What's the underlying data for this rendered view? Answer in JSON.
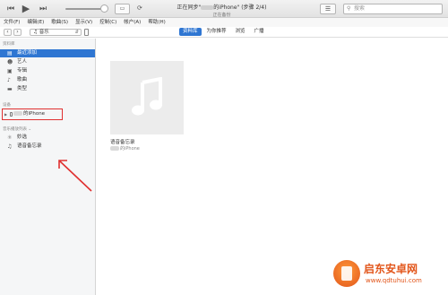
{
  "player": {
    "prev_icon": "previous-icon",
    "play_icon": "play-icon",
    "next_icon": "next-icon",
    "airplay_icon": "airplay-icon",
    "sync_icon": "sync-icon",
    "status_line1_prefix": "正在同步\"",
    "status_line1_suffix": "的iPhone\" (步骤 2/4)",
    "status_line2": "正在备份",
    "list_icon": "list-icon",
    "search_placeholder": "搜索"
  },
  "menu": [
    "文件(F)",
    "编辑(E)",
    "歌曲(S)",
    "显示(V)",
    "控制(C)",
    "帐户(A)",
    "帮助(H)"
  ],
  "nav": {
    "back": "‹",
    "forward": "›",
    "media_label": "音乐",
    "tabs": [
      "资料库",
      "为你推荐",
      "浏览",
      "广播"
    ],
    "active_tab": "资料库"
  },
  "sidebar": {
    "library_header": "资料库",
    "library_items": [
      {
        "label": "最近添加",
        "icon": "recent-icon",
        "selected": true
      },
      {
        "label": "艺人",
        "icon": "artist-icon",
        "selected": false
      },
      {
        "label": "专辑",
        "icon": "album-icon",
        "selected": false
      },
      {
        "label": "歌曲",
        "icon": "song-icon",
        "selected": false
      },
      {
        "label": "类型",
        "icon": "genre-icon",
        "selected": false
      }
    ],
    "devices_header": "设备",
    "device_name": "的iPhone",
    "playlists_header": "音乐播放列表 ⌄",
    "playlists": [
      {
        "label": "妙选",
        "icon": "genius-icon"
      },
      {
        "label": "语音备忘录",
        "icon": "playlist-icon"
      }
    ]
  },
  "content": {
    "album_title": "语音备忘录",
    "album_subtitle": "的iPhone",
    "album_art_icon": "music-note-icon"
  },
  "watermark": {
    "name": "启东安卓网",
    "url": "www.qdtuhui.com"
  },
  "colors": {
    "accent": "#2f76d2",
    "highlight_box": "#e03030",
    "watermark": "#e2551a"
  }
}
